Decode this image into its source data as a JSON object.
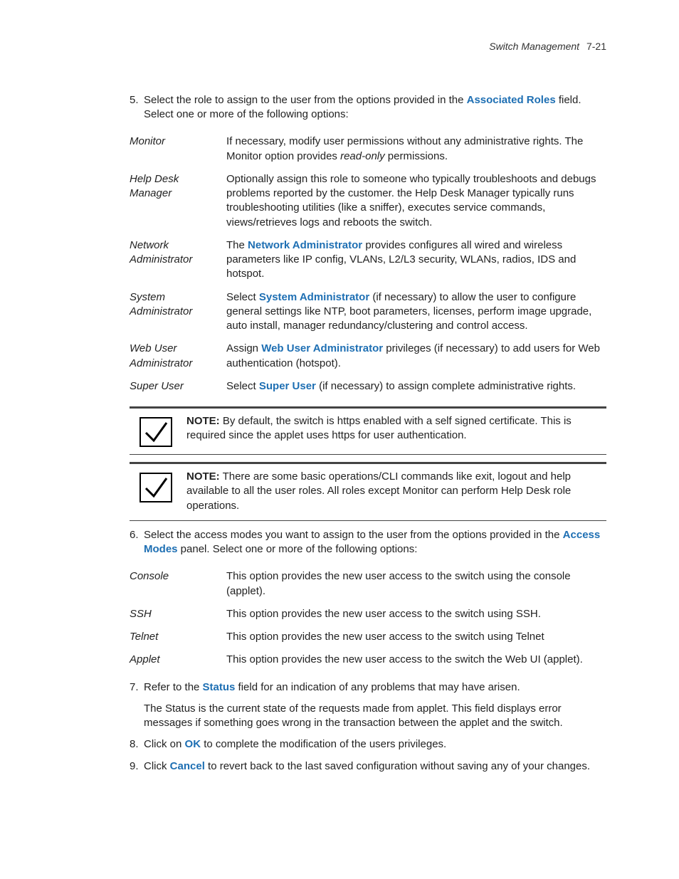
{
  "header": {
    "title": "Switch Management",
    "page": "7-21"
  },
  "step5": {
    "num": "5.",
    "pre": "Select the role to assign to the user from the options provided in the ",
    "field": "Associated Roles",
    "post": " field. Select one or more of the following options:"
  },
  "roles": [
    {
      "term": "Monitor",
      "desc_pre": "If necessary, modify user permissions without any administrative rights. The Monitor option provides ",
      "desc_ital": "read-only",
      "desc_post": " permissions."
    },
    {
      "term": "Help Desk Manager",
      "desc": "Optionally assign this role to someone who typically troubleshoots and debugs problems reported by the customer. the Help Desk Manager typically runs troubleshooting utilities (like a sniffer), executes service commands, views/retrieves logs and reboots the switch."
    },
    {
      "term": "Network Administrator",
      "desc_pre": "The ",
      "desc_link": "Network Administrator",
      "desc_post": " provides configures all wired and wireless parameters like IP config, VLANs, L2/L3 security, WLANs, radios, IDS and hotspot."
    },
    {
      "term": "System Administrator",
      "desc_pre": "Select ",
      "desc_link": "System Administrator",
      "desc_post": " (if necessary) to allow the user to configure general settings like NTP, boot parameters, licenses, perform image upgrade, auto install, manager redundancy/clustering and control access."
    },
    {
      "term": "Web User Administrator",
      "desc_pre": "Assign ",
      "desc_link": "Web User Administrator",
      "desc_post": " privileges (if necessary) to add users for Web authentication (hotspot)."
    },
    {
      "term": "Super User",
      "desc_pre": "Select ",
      "desc_link": "Super User",
      "desc_post": " (if necessary) to assign complete administrative rights."
    }
  ],
  "note1": {
    "label": "NOTE:",
    "text": " By default, the switch is https enabled with a self signed certificate. This is required since the applet uses https for user authentication."
  },
  "note2": {
    "label": "NOTE:",
    "text": " There are some basic operations/CLI commands like exit, logout and help available to all the user roles. All roles except Monitor can perform Help Desk role operations."
  },
  "step6": {
    "num": "6.",
    "pre": "Select the access modes you want to assign to the user from the options provided in the ",
    "field": "Access Modes",
    "post": " panel. Select one or more of the following options:"
  },
  "modes": [
    {
      "term": "Console",
      "desc": "This option provides the new user access to the switch using the console (applet)."
    },
    {
      "term": "SSH",
      "desc": "This option provides the new user access to the switch using SSH."
    },
    {
      "term": "Telnet",
      "desc": "This option provides the new user access to the switch using Telnet"
    },
    {
      "term": "Applet",
      "desc": "This option provides the new user access to the switch the Web UI (applet)."
    }
  ],
  "step7": {
    "num": "7.",
    "pre": "Refer to the ",
    "field": "Status",
    "post": " field for an indication of any problems that may have arisen.",
    "extra": "The Status is the current state of the requests made from applet. This field displays error messages if something goes wrong in the transaction between the applet and the switch."
  },
  "step8": {
    "num": "8.",
    "pre": "Click on ",
    "field": "OK",
    "post": " to complete the modification of the users privileges."
  },
  "step9": {
    "num": "9.",
    "pre": "Click ",
    "field": "Cancel",
    "post": " to revert back to the last saved configuration without saving any of your changes."
  }
}
